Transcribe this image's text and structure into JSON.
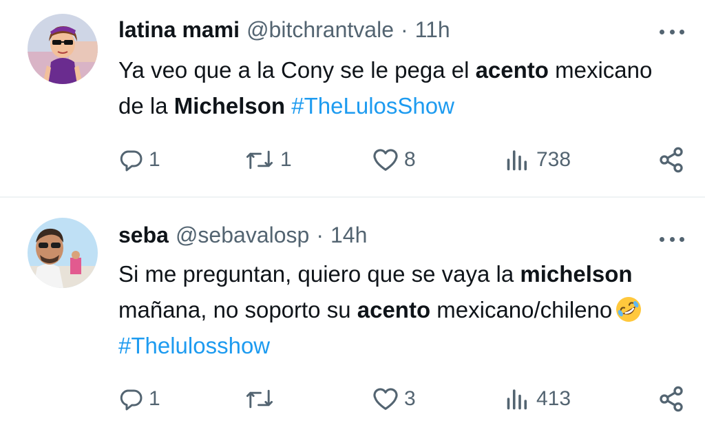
{
  "tweets": [
    {
      "name": "latina mami",
      "handle": "@bitchrantvale",
      "separator": "·",
      "time": "11h",
      "text": {
        "p1": "Ya veo que a la Cony se le pega el ",
        "b1": "acento",
        "p2": " mexicano de la ",
        "b2": "Michelson",
        "p3": " ",
        "hashtag": "#TheLulosShow"
      },
      "replies": "1",
      "retweets": "1",
      "likes": "8",
      "views": "738"
    },
    {
      "name": "seba",
      "handle": "@sebavalosp",
      "separator": "·",
      "time": "14h",
      "text": {
        "p1": "Si me preguntan, quiero que se vaya la ",
        "b1": "michelson",
        "p2": " mañana, no soporto su ",
        "b2": "acento",
        "p3": " mexicano/chileno",
        "hashtag": "#Thelulosshow"
      },
      "emoji": "rolling-on-floor-laughing",
      "replies": "1",
      "retweets": "",
      "likes": "3",
      "views": "413"
    }
  ],
  "colors": {
    "text": "#0f1419",
    "secondary": "#536471",
    "link": "#1d9bf0",
    "divider": "#eff3f4"
  },
  "icons": [
    "reply-icon",
    "retweet-icon",
    "like-icon",
    "views-icon",
    "share-icon",
    "more-icon"
  ]
}
